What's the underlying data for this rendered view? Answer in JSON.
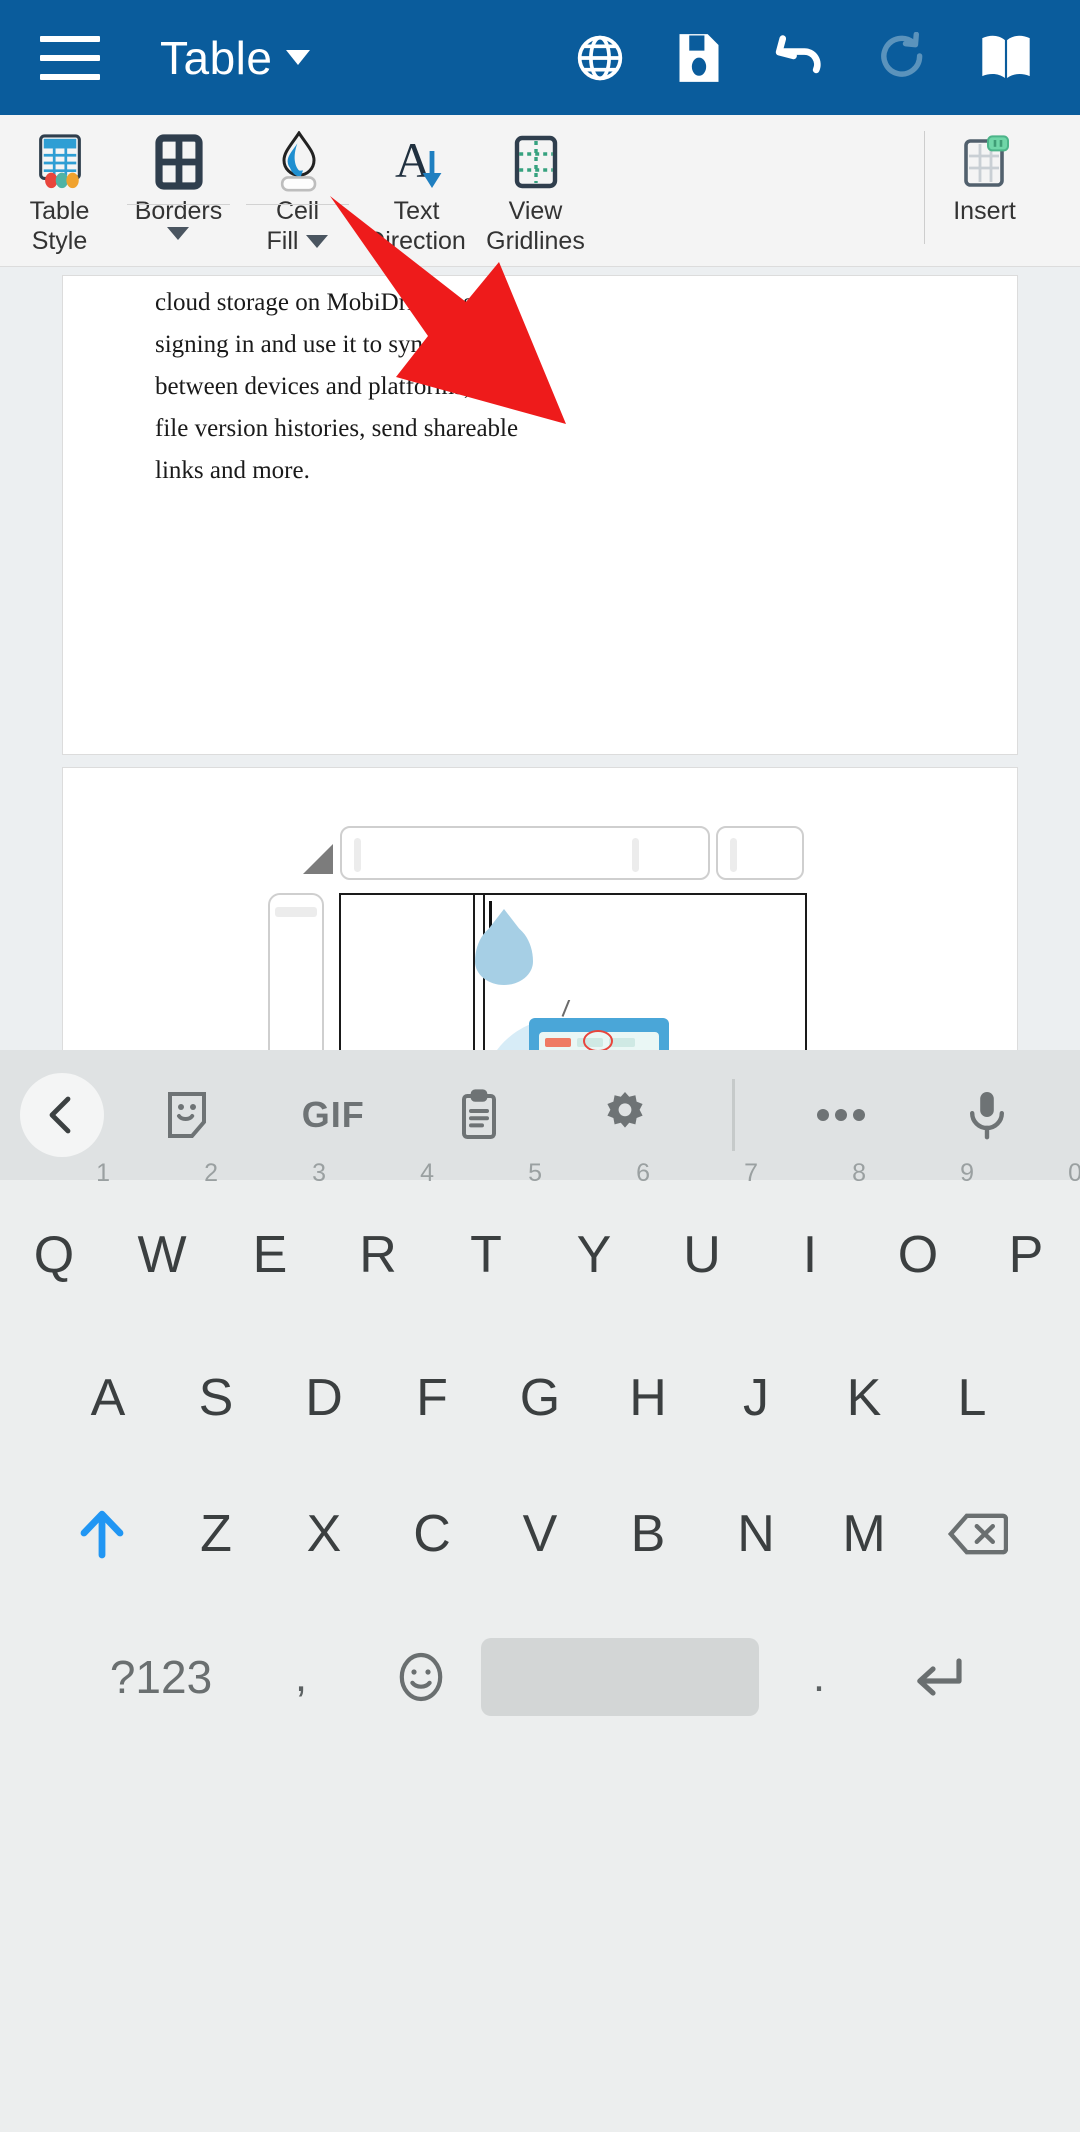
{
  "appbar": {
    "title": "Table",
    "menu_icon": "hamburger-menu-icon",
    "actions": [
      {
        "name": "globe-icon",
        "label": "Language"
      },
      {
        "name": "save-icon",
        "label": "Save"
      },
      {
        "name": "undo-icon",
        "label": "Undo"
      },
      {
        "name": "redo-icon",
        "label": "Redo"
      },
      {
        "name": "read-mode-book-icon",
        "label": "Read Mode"
      }
    ],
    "bg_color": "#0a5c9c"
  },
  "ribbon": {
    "items": [
      {
        "id": "table-style",
        "line1": "Table",
        "line2": "Style",
        "has_caret": false,
        "icon": "table-style-icon"
      },
      {
        "id": "borders",
        "line1": "Borders",
        "line2": "",
        "has_caret": true,
        "icon": "borders-icon"
      },
      {
        "id": "cell-fill",
        "line1": "Cell",
        "line2": "Fill",
        "has_caret": true,
        "icon": "cell-fill-paint-icon"
      },
      {
        "id": "text-direction",
        "line1": "Text",
        "line2": "Direction",
        "has_caret": false,
        "icon": "text-direction-icon"
      },
      {
        "id": "view-gridlines",
        "line1": "View",
        "line2": "Gridlines",
        "has_caret": false,
        "icon": "view-gridlines-icon"
      },
      {
        "id": "insert",
        "line1": "Insert",
        "line2": "",
        "has_caret": false,
        "icon": "insert-table-icon"
      }
    ]
  },
  "document": {
    "paragraph_lines": [
      "cloud storage on MobiDrive just by",
      "signing in and use it to sync files",
      "between devices and platforms, view",
      "file version histories, send shareable",
      "links and more."
    ]
  },
  "annotation": {
    "arrow_color": "#ee1b1b",
    "points_at": "cell-fill"
  },
  "keyboard": {
    "toolbar": [
      {
        "name": "back-chevron-icon",
        "label": "Back"
      },
      {
        "name": "sticker-icon",
        "label": "Stickers"
      },
      {
        "name": "gif-icon",
        "label": "GIF"
      },
      {
        "name": "clipboard-icon",
        "label": "Clipboard"
      },
      {
        "name": "settings-gear-icon",
        "label": "Settings"
      },
      {
        "name": "more-options-icon",
        "label": "More"
      },
      {
        "name": "microphone-icon",
        "label": "Voice input"
      }
    ],
    "row1": [
      {
        "key": "Q",
        "num": "1"
      },
      {
        "key": "W",
        "num": "2"
      },
      {
        "key": "E",
        "num": "3"
      },
      {
        "key": "R",
        "num": "4"
      },
      {
        "key": "T",
        "num": "5"
      },
      {
        "key": "Y",
        "num": "6"
      },
      {
        "key": "U",
        "num": "7"
      },
      {
        "key": "I",
        "num": "8"
      },
      {
        "key": "O",
        "num": "9"
      },
      {
        "key": "P",
        "num": "0"
      }
    ],
    "row2": [
      "A",
      "S",
      "D",
      "F",
      "G",
      "H",
      "J",
      "K",
      "L"
    ],
    "row3": [
      "Z",
      "X",
      "C",
      "V",
      "B",
      "N",
      "M"
    ],
    "row3_shift": "shift-up-icon",
    "row3_backspace": "backspace-icon",
    "row4": {
      "symbols": "?123",
      "comma": ",",
      "emoji": "emoji-smiley-icon",
      "space": "",
      "period": ".",
      "enter": "enter-return-icon"
    }
  }
}
